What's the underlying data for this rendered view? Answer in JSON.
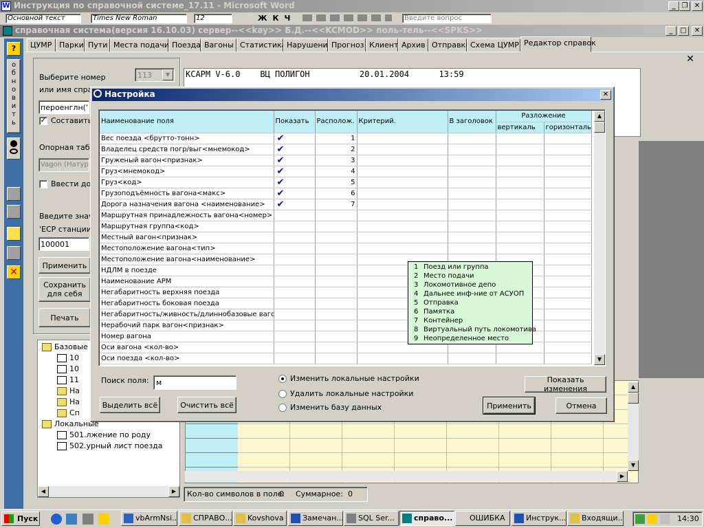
{
  "word": {
    "title": "Инструкция по справочной системе_17.11 - Microsoft Word",
    "style": "Основной текст",
    "font": "Times New Roman",
    "size": "12",
    "search_hint": "Введите вопрос"
  },
  "app": {
    "title": "справочная система(версия 16.10.03) сервер--<<kay>> Б.Д.--<<KCMOD>> поль-тель--<<SPKS>>"
  },
  "tabs": [
    "ЦУМР",
    "Парки",
    "Пути",
    "Места подачи",
    "Поезда",
    "Вагоны",
    "Статистика",
    "Нарушения",
    "Прогноз",
    "Клиент",
    "Архив",
    "Отправки",
    "Схема ЦУМР",
    "Редактор справок"
  ],
  "vertical_button": {
    "letters": [
      "о",
      "б",
      "н",
      "о",
      "в",
      "и",
      "т",
      "ь"
    ]
  },
  "left": {
    "select_label_1": "Выберите номер",
    "select_label_2": "или имя справ",
    "select_value": "113",
    "name_input": "пероенглн('И",
    "compose_label": "Составить",
    "base_table_label": "Опорная табл",
    "base_table_value": "Vagon (Натур",
    "enter_label": "Ввести до",
    "value_label": "Введите значе",
    "esr_label": "'ЕСР станции",
    "esr_value": "100001",
    "apply": "Применить",
    "save": "Сохранить для себя",
    "print": "Печать"
  },
  "tree": [
    {
      "label": "Базовые",
      "level": 0,
      "icon": "folder"
    },
    {
      "label": "10",
      "level": 1,
      "icon": "doc"
    },
    {
      "label": "10",
      "level": 1,
      "icon": "doc"
    },
    {
      "label": "11",
      "level": 1,
      "icon": "doc"
    },
    {
      "label": "На",
      "level": 1,
      "icon": "folder"
    },
    {
      "label": "На",
      "level": 1,
      "icon": "folder"
    },
    {
      "label": "Сп",
      "level": 1,
      "icon": "folder"
    },
    {
      "label": "Локальные",
      "level": 0,
      "icon": "folder"
    },
    {
      "label": "501.лжение по роду",
      "level": 1,
      "icon": "doc"
    },
    {
      "label": "502.урный лист поезда",
      "level": 1,
      "icon": "doc"
    }
  ],
  "report": {
    "line": "КСАРМ V-6.0    ВЦ ПОЛИГОН          20.01.2004      13:59"
  },
  "status": {
    "chars_label": "Кол-во символов в поле:",
    "chars_value": "0",
    "total_label": "Суммарное:",
    "total_value": "0"
  },
  "dialog": {
    "title": "Настройка",
    "columns": {
      "name": "Наименование поля",
      "show": "Показать",
      "pos": "Располож.",
      "crit": "Критерий.",
      "header": "В заголовок",
      "split": "Разложение",
      "vert": "вертикаль",
      "horiz": "горизонталь"
    },
    "rows": [
      {
        "name": "Вес поезда <брутто-тонн>",
        "show": true,
        "pos": "1"
      },
      {
        "name": "Владелец средств погр/выг<мнемокод>",
        "show": true,
        "pos": "2"
      },
      {
        "name": "Груженый вагон<признак>",
        "show": true,
        "pos": "3"
      },
      {
        "name": "Груз<мнемокод>",
        "show": true,
        "pos": "4"
      },
      {
        "name": "Груз<код>",
        "show": true,
        "pos": "5"
      },
      {
        "name": "Грузоподъёмность вагона<макс>",
        "show": true,
        "pos": "6"
      },
      {
        "name": "Дорога назначения вагона <наименование>",
        "show": true,
        "pos": "7"
      },
      {
        "name": "Маршрутная принадлежность вагона<номер>",
        "show": false,
        "pos": ""
      },
      {
        "name": "Маршрутная группа<код>",
        "show": false,
        "pos": ""
      },
      {
        "name": "Местный вагон<признак>",
        "show": false,
        "pos": ""
      },
      {
        "name": "Местоположение вагона<тип>",
        "show": false,
        "pos": ""
      },
      {
        "name": "Местоположение вагона<наименование>",
        "show": false,
        "pos": ""
      },
      {
        "name": "НДЛМ в поезде",
        "show": false,
        "pos": ""
      },
      {
        "name": "Наименование АРМ",
        "show": false,
        "pos": ""
      },
      {
        "name": "Негабаритность верхняя поезда",
        "show": false,
        "pos": ""
      },
      {
        "name": "Негабаритность боковая поезда",
        "show": false,
        "pos": ""
      },
      {
        "name": "Негабаритность/живность/длиннобазовые вагс",
        "show": false,
        "pos": ""
      },
      {
        "name": "Нерабочий парк вагон<признак>",
        "show": false,
        "pos": ""
      },
      {
        "name": "Номер вагона",
        "show": false,
        "pos": ""
      },
      {
        "name": "Оси вагона <кол-во>",
        "show": false,
        "pos": ""
      },
      {
        "name": "Оси поезда <кол-во>",
        "show": false,
        "pos": ""
      }
    ],
    "popup": [
      {
        "n": "1",
        "t": "Поезд или группа"
      },
      {
        "n": "2",
        "t": "Место подачи"
      },
      {
        "n": "3",
        "t": "Локомотивное депо"
      },
      {
        "n": "4",
        "t": "Дальнее инф-ние от АСУОП"
      },
      {
        "n": "5",
        "t": "Отправка"
      },
      {
        "n": "6",
        "t": "Памятка"
      },
      {
        "n": "7",
        "t": "Контейнер"
      },
      {
        "n": "8",
        "t": "Виртуальный путь локомотива"
      },
      {
        "n": "9",
        "t": "Неопределенное место"
      }
    ],
    "search_label": "Поиск поля:",
    "search_value": "м",
    "select_all": "Выделить всё",
    "clear_all": "Очистить всё",
    "radio_1": "Изменить локальные настройки",
    "radio_2": "Удалить локальные настройки",
    "radio_3": "Изменить базу данных",
    "show_changes": "Показать изменения",
    "apply": "Применить",
    "cancel": "Отмена"
  },
  "taskbar": {
    "start": "Пуск",
    "items": [
      "vbArmNsi...",
      "СПРАВО...",
      "Kovshova",
      "Замечан...",
      "SQL Ser...",
      "справо...",
      "ОШИБКА",
      "Инструк...",
      "Входящи..."
    ],
    "clock": "14:30"
  },
  "colors": {
    "titlebar": "#0a246a",
    "header": "#bff0f8",
    "popup": "#d8f8d8",
    "grid": "#fbf8d0",
    "check": "#0000c0"
  }
}
